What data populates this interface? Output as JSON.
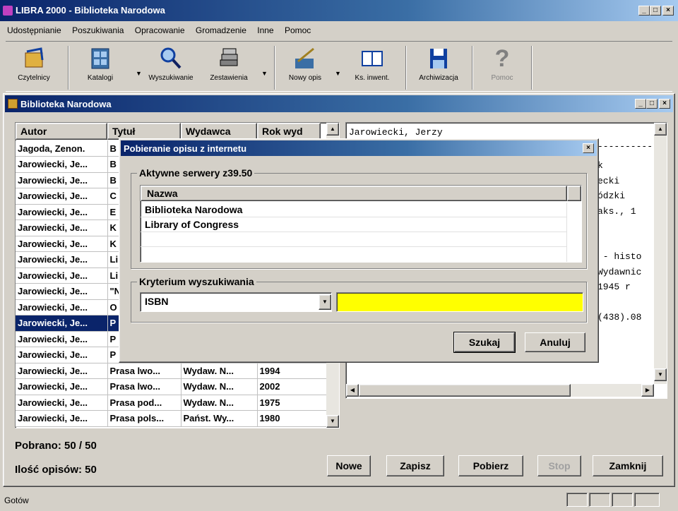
{
  "app": {
    "title": "LIBRA 2000 - Biblioteka Narodowa"
  },
  "menu": [
    "Udostępnianie",
    "Poszukiwania",
    "Opracowanie",
    "Gromadzenie",
    "Inne",
    "Pomoc"
  ],
  "toolbar": {
    "czytelnicy": "Czytelnicy",
    "katalogi": "Katalogi",
    "wyszukiwanie": "Wyszukiwanie",
    "zestawienia": "Zestawienia",
    "nowy_opis": "Nowy opis",
    "ks_inwent": "Ks. inwent.",
    "archiwizacja": "Archiwizacja",
    "pomoc": "Pomoc"
  },
  "child": {
    "title": "Biblioteka Narodowa"
  },
  "table": {
    "headers": [
      "Autor",
      "Tytuł",
      "Wydawca",
      "Rok wyd"
    ],
    "rows": [
      [
        "Jagoda, Zenon.",
        "B",
        "",
        ""
      ],
      [
        "Jarowiecki, Je...",
        "B",
        "",
        ""
      ],
      [
        "Jarowiecki, Je...",
        "B",
        "",
        ""
      ],
      [
        "Jarowiecki, Je...",
        "C",
        "",
        ""
      ],
      [
        "Jarowiecki, Je...",
        "E",
        "",
        ""
      ],
      [
        "Jarowiecki, Je...",
        "K",
        "",
        ""
      ],
      [
        "Jarowiecki, Je...",
        "K",
        "",
        ""
      ],
      [
        "Jarowiecki, Je...",
        "Li",
        "",
        ""
      ],
      [
        "Jarowiecki, Je...",
        "Li",
        "",
        ""
      ],
      [
        "Jarowiecki, Je...",
        "\"N",
        "",
        ""
      ],
      [
        "Jarowiecki, Je...",
        "O",
        "",
        ""
      ],
      [
        "Jarowiecki, Je...",
        "P",
        "",
        ""
      ],
      [
        "Jarowiecki, Je...",
        "P",
        "",
        ""
      ],
      [
        "Jarowiecki, Je...",
        "P",
        "",
        ""
      ],
      [
        "Jarowiecki, Je...",
        "Prasa lwo...",
        "Wydaw. N...",
        "1994"
      ],
      [
        "Jarowiecki, Je...",
        "Prasa lwo...",
        "Wydaw. N...",
        "2002"
      ],
      [
        "Jarowiecki, Je...",
        "Prasa pod...",
        "Wydaw. N...",
        "1975"
      ],
      [
        "Jarowiecki, Je...",
        "Prasa pols...",
        "Państ. Wy...",
        "1980"
      ]
    ],
    "selected_index": 11
  },
  "record_text": {
    "top": "Jarowiecki, Jerzy",
    "dashes": "----------",
    "lines": [
      "k",
      "ecki",
      "ódzki",
      "aks., 1",
      "",
      "",
      " - histo",
      "Wydawnic",
      "1945 r",
      "",
      "(438).08"
    ]
  },
  "status": {
    "pobrano_label": "Pobrano: 50 / 50",
    "ilosc_label": "Ilość opisów: 50",
    "bottom": "Gotów"
  },
  "buttons": {
    "nowe": "Nowe",
    "zapisz": "Zapisz",
    "pobierz": "Pobierz",
    "stop": "Stop",
    "zamknij": "Zamknij"
  },
  "dialog": {
    "title": "Pobieranie opisu z internetu",
    "servers_legend": "Aktywne serwery z39.50",
    "col_header": "Nazwa",
    "servers": [
      "Biblioteka Narodowa",
      "Library of Congress"
    ],
    "criteria_legend": "Kryterium wyszukiwania",
    "criteria_value": "ISBN",
    "search_value": "",
    "search_button": "Szukaj",
    "cancel_button": "Anuluj",
    "search_field_color": "#ffff00"
  }
}
